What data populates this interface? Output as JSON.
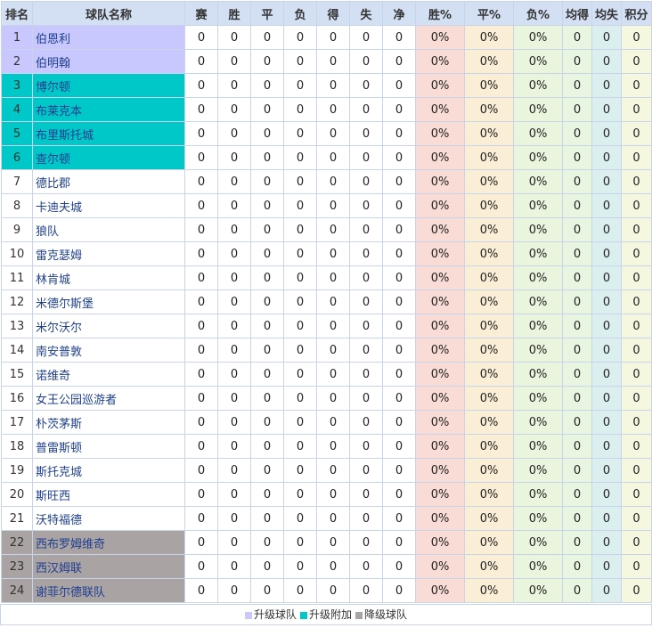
{
  "headers": [
    "排名",
    "球队名称",
    "赛",
    "胜",
    "平",
    "负",
    "得",
    "失",
    "净",
    "胜%",
    "平%",
    "负%",
    "均得",
    "均失",
    "积分"
  ],
  "colors": {
    "promotion": "#c8c8ff",
    "playoff": "#00c8c8",
    "relegation": "#aaa3a3",
    "header": "#d3dff3"
  },
  "rows": [
    {
      "rank": "1",
      "team": "伯恩利",
      "zone": "promotion",
      "played": "0",
      "win": "0",
      "draw": "0",
      "loss": "0",
      "gf": "0",
      "ga": "0",
      "gd": "0",
      "wp": "0%",
      "dp": "0%",
      "lp": "0%",
      "avgf": "0",
      "avga": "0",
      "pts": "0"
    },
    {
      "rank": "2",
      "team": "伯明翰",
      "zone": "promotion",
      "played": "0",
      "win": "0",
      "draw": "0",
      "loss": "0",
      "gf": "0",
      "ga": "0",
      "gd": "0",
      "wp": "0%",
      "dp": "0%",
      "lp": "0%",
      "avgf": "0",
      "avga": "0",
      "pts": "0"
    },
    {
      "rank": "3",
      "team": "博尔顿",
      "zone": "playoff",
      "played": "0",
      "win": "0",
      "draw": "0",
      "loss": "0",
      "gf": "0",
      "ga": "0",
      "gd": "0",
      "wp": "0%",
      "dp": "0%",
      "lp": "0%",
      "avgf": "0",
      "avga": "0",
      "pts": "0"
    },
    {
      "rank": "4",
      "team": "布莱克本",
      "zone": "playoff",
      "played": "0",
      "win": "0",
      "draw": "0",
      "loss": "0",
      "gf": "0",
      "ga": "0",
      "gd": "0",
      "wp": "0%",
      "dp": "0%",
      "lp": "0%",
      "avgf": "0",
      "avga": "0",
      "pts": "0"
    },
    {
      "rank": "5",
      "team": "布里斯托城",
      "zone": "playoff",
      "played": "0",
      "win": "0",
      "draw": "0",
      "loss": "0",
      "gf": "0",
      "ga": "0",
      "gd": "0",
      "wp": "0%",
      "dp": "0%",
      "lp": "0%",
      "avgf": "0",
      "avga": "0",
      "pts": "0"
    },
    {
      "rank": "6",
      "team": "查尔顿",
      "zone": "playoff",
      "played": "0",
      "win": "0",
      "draw": "0",
      "loss": "0",
      "gf": "0",
      "ga": "0",
      "gd": "0",
      "wp": "0%",
      "dp": "0%",
      "lp": "0%",
      "avgf": "0",
      "avga": "0",
      "pts": "0"
    },
    {
      "rank": "7",
      "team": "德比郡",
      "zone": "",
      "played": "0",
      "win": "0",
      "draw": "0",
      "loss": "0",
      "gf": "0",
      "ga": "0",
      "gd": "0",
      "wp": "0%",
      "dp": "0%",
      "lp": "0%",
      "avgf": "0",
      "avga": "0",
      "pts": "0"
    },
    {
      "rank": "8",
      "team": "卡迪夫城",
      "zone": "",
      "played": "0",
      "win": "0",
      "draw": "0",
      "loss": "0",
      "gf": "0",
      "ga": "0",
      "gd": "0",
      "wp": "0%",
      "dp": "0%",
      "lp": "0%",
      "avgf": "0",
      "avga": "0",
      "pts": "0"
    },
    {
      "rank": "9",
      "team": "狼队",
      "zone": "",
      "played": "0",
      "win": "0",
      "draw": "0",
      "loss": "0",
      "gf": "0",
      "ga": "0",
      "gd": "0",
      "wp": "0%",
      "dp": "0%",
      "lp": "0%",
      "avgf": "0",
      "avga": "0",
      "pts": "0"
    },
    {
      "rank": "10",
      "team": "雷克瑟姆",
      "zone": "",
      "played": "0",
      "win": "0",
      "draw": "0",
      "loss": "0",
      "gf": "0",
      "ga": "0",
      "gd": "0",
      "wp": "0%",
      "dp": "0%",
      "lp": "0%",
      "avgf": "0",
      "avga": "0",
      "pts": "0"
    },
    {
      "rank": "11",
      "team": "林肯城",
      "zone": "",
      "played": "0",
      "win": "0",
      "draw": "0",
      "loss": "0",
      "gf": "0",
      "ga": "0",
      "gd": "0",
      "wp": "0%",
      "dp": "0%",
      "lp": "0%",
      "avgf": "0",
      "avga": "0",
      "pts": "0"
    },
    {
      "rank": "12",
      "team": "米德尔斯堡",
      "zone": "",
      "played": "0",
      "win": "0",
      "draw": "0",
      "loss": "0",
      "gf": "0",
      "ga": "0",
      "gd": "0",
      "wp": "0%",
      "dp": "0%",
      "lp": "0%",
      "avgf": "0",
      "avga": "0",
      "pts": "0"
    },
    {
      "rank": "13",
      "team": "米尔沃尔",
      "zone": "",
      "played": "0",
      "win": "0",
      "draw": "0",
      "loss": "0",
      "gf": "0",
      "ga": "0",
      "gd": "0",
      "wp": "0%",
      "dp": "0%",
      "lp": "0%",
      "avgf": "0",
      "avga": "0",
      "pts": "0"
    },
    {
      "rank": "14",
      "team": "南安普敦",
      "zone": "",
      "played": "0",
      "win": "0",
      "draw": "0",
      "loss": "0",
      "gf": "0",
      "ga": "0",
      "gd": "0",
      "wp": "0%",
      "dp": "0%",
      "lp": "0%",
      "avgf": "0",
      "avga": "0",
      "pts": "0"
    },
    {
      "rank": "15",
      "team": "诺维奇",
      "zone": "",
      "played": "0",
      "win": "0",
      "draw": "0",
      "loss": "0",
      "gf": "0",
      "ga": "0",
      "gd": "0",
      "wp": "0%",
      "dp": "0%",
      "lp": "0%",
      "avgf": "0",
      "avga": "0",
      "pts": "0"
    },
    {
      "rank": "16",
      "team": "女王公园巡游者",
      "zone": "",
      "played": "0",
      "win": "0",
      "draw": "0",
      "loss": "0",
      "gf": "0",
      "ga": "0",
      "gd": "0",
      "wp": "0%",
      "dp": "0%",
      "lp": "0%",
      "avgf": "0",
      "avga": "0",
      "pts": "0"
    },
    {
      "rank": "17",
      "team": "朴茨茅斯",
      "zone": "",
      "played": "0",
      "win": "0",
      "draw": "0",
      "loss": "0",
      "gf": "0",
      "ga": "0",
      "gd": "0",
      "wp": "0%",
      "dp": "0%",
      "lp": "0%",
      "avgf": "0",
      "avga": "0",
      "pts": "0"
    },
    {
      "rank": "18",
      "team": "普雷斯顿",
      "zone": "",
      "played": "0",
      "win": "0",
      "draw": "0",
      "loss": "0",
      "gf": "0",
      "ga": "0",
      "gd": "0",
      "wp": "0%",
      "dp": "0%",
      "lp": "0%",
      "avgf": "0",
      "avga": "0",
      "pts": "0"
    },
    {
      "rank": "19",
      "team": "斯托克城",
      "zone": "",
      "played": "0",
      "win": "0",
      "draw": "0",
      "loss": "0",
      "gf": "0",
      "ga": "0",
      "gd": "0",
      "wp": "0%",
      "dp": "0%",
      "lp": "0%",
      "avgf": "0",
      "avga": "0",
      "pts": "0"
    },
    {
      "rank": "20",
      "team": "斯旺西",
      "zone": "",
      "played": "0",
      "win": "0",
      "draw": "0",
      "loss": "0",
      "gf": "0",
      "ga": "0",
      "gd": "0",
      "wp": "0%",
      "dp": "0%",
      "lp": "0%",
      "avgf": "0",
      "avga": "0",
      "pts": "0"
    },
    {
      "rank": "21",
      "team": "沃特福德",
      "zone": "",
      "played": "0",
      "win": "0",
      "draw": "0",
      "loss": "0",
      "gf": "0",
      "ga": "0",
      "gd": "0",
      "wp": "0%",
      "dp": "0%",
      "lp": "0%",
      "avgf": "0",
      "avga": "0",
      "pts": "0"
    },
    {
      "rank": "22",
      "team": "西布罗姆维奇",
      "zone": "relegation",
      "played": "0",
      "win": "0",
      "draw": "0",
      "loss": "0",
      "gf": "0",
      "ga": "0",
      "gd": "0",
      "wp": "0%",
      "dp": "0%",
      "lp": "0%",
      "avgf": "0",
      "avga": "0",
      "pts": "0"
    },
    {
      "rank": "23",
      "team": "西汉姆联",
      "zone": "relegation",
      "played": "0",
      "win": "0",
      "draw": "0",
      "loss": "0",
      "gf": "0",
      "ga": "0",
      "gd": "0",
      "wp": "0%",
      "dp": "0%",
      "lp": "0%",
      "avgf": "0",
      "avga": "0",
      "pts": "0"
    },
    {
      "rank": "24",
      "team": "谢菲尔德联队",
      "zone": "relegation",
      "played": "0",
      "win": "0",
      "draw": "0",
      "loss": "0",
      "gf": "0",
      "ga": "0",
      "gd": "0",
      "wp": "0%",
      "dp": "0%",
      "lp": "0%",
      "avgf": "0",
      "avga": "0",
      "pts": "0"
    }
  ],
  "legend": [
    {
      "label": "升级球队",
      "zone": "promotion"
    },
    {
      "label": "升级附加",
      "zone": "playoff"
    },
    {
      "label": "降级球队",
      "zone": "relegation"
    }
  ]
}
